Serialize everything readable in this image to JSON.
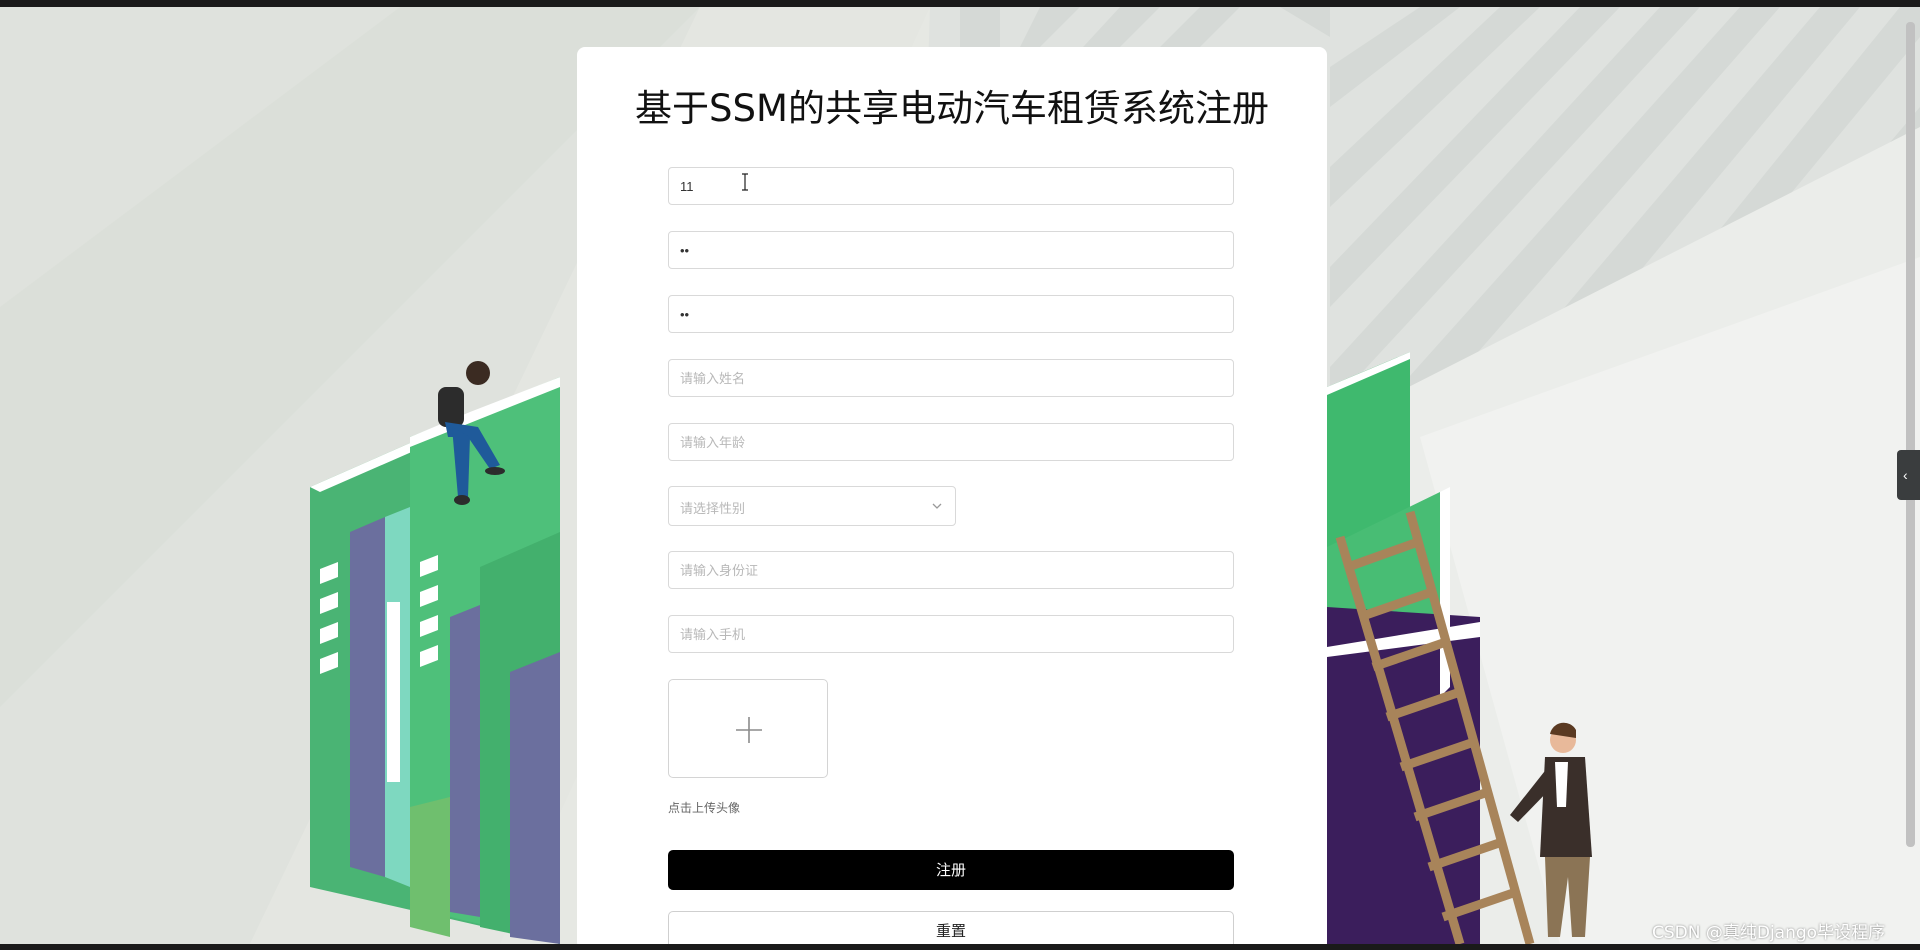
{
  "page": {
    "title": "基于SSM的共享电动汽车租赁系统注册"
  },
  "form": {
    "account_value": "11",
    "password_value": "••",
    "confirm_password_value": "••",
    "name_placeholder": "请输入姓名",
    "age_placeholder": "请输入年龄",
    "gender_placeholder": "请选择性别",
    "id_card_placeholder": "请输入身份证",
    "phone_placeholder": "请输入手机",
    "avatar_hint": "点击上传头像",
    "register_label": "注册",
    "reset_label": "重置"
  },
  "watermark": "CSDN @真纯Django毕设程序",
  "colors": {
    "primary_button": "#000000",
    "card": "#ffffff",
    "book_green": "#3fb96e",
    "book_purple": "#6b6f9e"
  },
  "icons": {
    "side_handle": "chevron-left-icon",
    "select": "chevron-down-icon",
    "upload": "plus-icon"
  }
}
